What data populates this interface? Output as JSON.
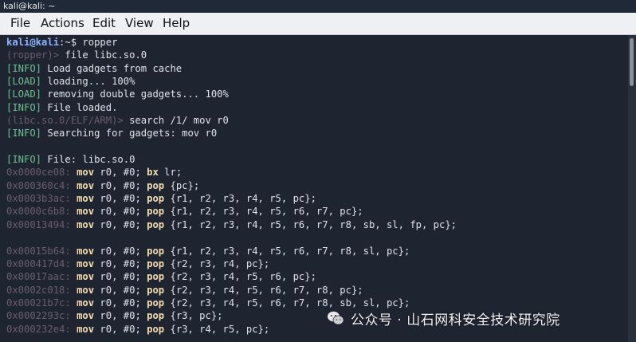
{
  "window": {
    "title": "kali@kali: ~"
  },
  "menu": [
    "File",
    "Actions",
    "Edit",
    "View",
    "Help"
  ],
  "colors": {
    "user": "#8fb4ff",
    "info": "#6fbf8f",
    "dim": "#6a5d73",
    "keyword": "#f5deb3",
    "text": "#dfe3ea"
  },
  "terminal": {
    "lines": [
      [
        {
          "t": "kali@kali",
          "c": "user",
          "b": true
        },
        {
          "t": ":~$ ropper",
          "c": "text"
        }
      ],
      [
        {
          "t": "(ropper)> ",
          "c": "dim"
        },
        {
          "t": "file libc.so.0",
          "c": "text"
        }
      ],
      [
        {
          "t": "[INFO]",
          "c": "info"
        },
        {
          "t": " Load gadgets from cache",
          "c": "text"
        }
      ],
      [
        {
          "t": "[LOAD]",
          "c": "info"
        },
        {
          "t": " loading... 100%",
          "c": "text"
        }
      ],
      [
        {
          "t": "[LOAD]",
          "c": "info"
        },
        {
          "t": " removing double gadgets... 100%",
          "c": "text"
        }
      ],
      [
        {
          "t": "[INFO]",
          "c": "info"
        },
        {
          "t": " File loaded.",
          "c": "text"
        }
      ],
      [
        {
          "t": "(libc.so.0/ELF/ARM)> ",
          "c": "dim"
        },
        {
          "t": "search /1/ mov r0",
          "c": "text"
        }
      ],
      [
        {
          "t": "[INFO]",
          "c": "info"
        },
        {
          "t": " Searching for gadgets: mov r0",
          "c": "text"
        }
      ],
      [],
      [
        {
          "t": "[INFO]",
          "c": "info"
        },
        {
          "t": " File: libc.so.0",
          "c": "text"
        }
      ],
      [
        {
          "t": "0x0000ce08: ",
          "c": "dim"
        },
        {
          "t": "mov",
          "c": "keyword",
          "b": true
        },
        {
          "t": " r0, #0; ",
          "c": "text"
        },
        {
          "t": "bx",
          "c": "keyword",
          "b": true
        },
        {
          "t": " lr;",
          "c": "text"
        }
      ],
      [
        {
          "t": "0x000360c4: ",
          "c": "dim"
        },
        {
          "t": "mov",
          "c": "keyword",
          "b": true
        },
        {
          "t": " r0, #0; ",
          "c": "text"
        },
        {
          "t": "pop",
          "c": "keyword",
          "b": true
        },
        {
          "t": " {pc};",
          "c": "text"
        }
      ],
      [
        {
          "t": "0x0003b3ac: ",
          "c": "dim"
        },
        {
          "t": "mov",
          "c": "keyword",
          "b": true
        },
        {
          "t": " r0, #0; ",
          "c": "text"
        },
        {
          "t": "pop",
          "c": "keyword",
          "b": true
        },
        {
          "t": " {r1, r2, r3, r4, r5, pc};",
          "c": "text"
        }
      ],
      [
        {
          "t": "0x0000c6b8: ",
          "c": "dim"
        },
        {
          "t": "mov",
          "c": "keyword",
          "b": true
        },
        {
          "t": " r0, #0; ",
          "c": "text"
        },
        {
          "t": "pop",
          "c": "keyword",
          "b": true
        },
        {
          "t": " {r1, r2, r3, r4, r5, r6, r7, pc};",
          "c": "text"
        }
      ],
      [
        {
          "t": "0x00013494: ",
          "c": "dim"
        },
        {
          "t": "mov",
          "c": "keyword",
          "b": true
        },
        {
          "t": " r0, #0; ",
          "c": "text"
        },
        {
          "t": "pop",
          "c": "keyword",
          "b": true
        },
        {
          "t": " {r1, r2, r3, r4, r5, r6, r7, r8, sb, sl, fp, pc};",
          "c": "text"
        }
      ],
      [],
      [
        {
          "t": "0x00015b64: ",
          "c": "dim"
        },
        {
          "t": "mov",
          "c": "keyword",
          "b": true
        },
        {
          "t": " r0, #0; ",
          "c": "text"
        },
        {
          "t": "pop",
          "c": "keyword",
          "b": true
        },
        {
          "t": " {r1, r2, r3, r4, r5, r6, r7, r8, sl, pc};",
          "c": "text"
        }
      ],
      [
        {
          "t": "0x000417d4: ",
          "c": "dim"
        },
        {
          "t": "mov",
          "c": "keyword",
          "b": true
        },
        {
          "t": " r0, #0; ",
          "c": "text"
        },
        {
          "t": "pop",
          "c": "keyword",
          "b": true
        },
        {
          "t": " {r2, r3, r4, pc};",
          "c": "text"
        }
      ],
      [
        {
          "t": "0x00017aac: ",
          "c": "dim"
        },
        {
          "t": "mov",
          "c": "keyword",
          "b": true
        },
        {
          "t": " r0, #0; ",
          "c": "text"
        },
        {
          "t": "pop",
          "c": "keyword",
          "b": true
        },
        {
          "t": " {r2, r3, r4, r5, r6, pc};",
          "c": "text"
        }
      ],
      [
        {
          "t": "0x0002c018: ",
          "c": "dim"
        },
        {
          "t": "mov",
          "c": "keyword",
          "b": true
        },
        {
          "t": " r0, #0; ",
          "c": "text"
        },
        {
          "t": "pop",
          "c": "keyword",
          "b": true
        },
        {
          "t": " {r2, r3, r4, r5, r6, r7, r8, pc};",
          "c": "text"
        }
      ],
      [
        {
          "t": "0x00021b7c: ",
          "c": "dim"
        },
        {
          "t": "mov",
          "c": "keyword",
          "b": true
        },
        {
          "t": " r0, #0; ",
          "c": "text"
        },
        {
          "t": "pop",
          "c": "keyword",
          "b": true
        },
        {
          "t": " {r2, r3, r4, r5, r6, r7, r8, sb, sl, pc};",
          "c": "text"
        }
      ],
      [
        {
          "t": "0x0002293c: ",
          "c": "dim"
        },
        {
          "t": "mov",
          "c": "keyword",
          "b": true
        },
        {
          "t": " r0, #0; ",
          "c": "text"
        },
        {
          "t": "pop",
          "c": "keyword",
          "b": true
        },
        {
          "t": " {r3, pc};",
          "c": "text"
        }
      ],
      [
        {
          "t": "0x000232e4: ",
          "c": "dim"
        },
        {
          "t": "mov",
          "c": "keyword",
          "b": true
        },
        {
          "t": " r0, #0; ",
          "c": "text"
        },
        {
          "t": "pop",
          "c": "keyword",
          "b": true
        },
        {
          "t": " {r3, r4, r5, pc};",
          "c": "text"
        }
      ]
    ]
  },
  "watermark": {
    "text": "公众号 · 山石网科安全技术研究院",
    "icon": "wechat-icon"
  }
}
